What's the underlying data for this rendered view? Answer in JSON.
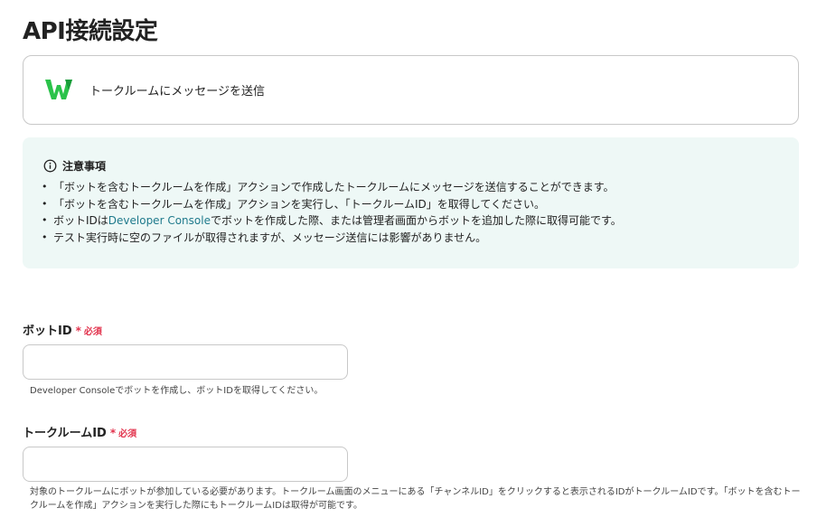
{
  "page": {
    "title": "API接続設定"
  },
  "action": {
    "label": "トークルームにメッセージを送信",
    "icon": "lineworks-logo-icon",
    "icon_color": "#2bc24a"
  },
  "notice": {
    "title": "注意事項",
    "items": [
      {
        "text": "「ボットを含むトークルームを作成」アクションで作成したトークルームにメッセージを送信することができます。"
      },
      {
        "text": "「ボットを含むトークルームを作成」アクションを実行し、「トークルームID」を取得してください。"
      },
      {
        "before": "ボットIDは",
        "link": "Developer Console",
        "after": "でボットを作成した際、または管理者画面からボットを追加した際に取得可能です。"
      },
      {
        "text": "テスト実行時に空のファイルが取得されますが、メッセージ送信には影響がありません。"
      }
    ],
    "background": "#eef8f6",
    "link_color": "#1f7a8c"
  },
  "fields": {
    "bot_id": {
      "label": "ボットID",
      "required_star": "*",
      "required_text": "必須",
      "value": "",
      "help": "Developer Consoleでボットを作成し、ボットIDを取得してください。"
    },
    "room_id": {
      "label": "トークルームID",
      "required_star": "*",
      "required_text": "必須",
      "value": "",
      "help_line1": "対象のトークルームにボットが参加している必要があります。トークルーム画面のメニューにある「チャンネルID」をクリックすると表示されるIDがトークルームIDです。「ボットを含むトー",
      "help_line2": "クルームを作成」アクションを実行した際にもトークルームIDは取得が可能です。"
    }
  },
  "colors": {
    "required": "#e2334d",
    "border": "#c8c8c8"
  }
}
